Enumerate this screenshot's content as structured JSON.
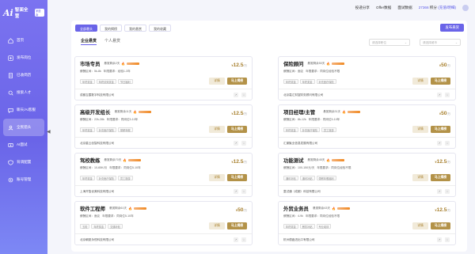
{
  "app": {
    "logo_mark": "Ai",
    "name": "智面全营",
    "tag": "家庭版"
  },
  "sidebar": {
    "items": [
      {
        "label": "首页",
        "icon": "home-icon",
        "active": false
      },
      {
        "label": "发布岗位",
        "icon": "post-icon",
        "active": false
      },
      {
        "label": "已收简历",
        "icon": "resume-icon",
        "active": false
      },
      {
        "label": "搜索人才",
        "icon": "search-icon",
        "active": false
      },
      {
        "label": "聊天/AI客服",
        "icon": "chat-icon",
        "active": false
      },
      {
        "label": "全民猎头",
        "icon": "hunter-icon",
        "active": true
      },
      {
        "label": "AI面试",
        "icon": "interview-icon",
        "active": false
      },
      {
        "label": "背调配置",
        "icon": "check-icon",
        "active": false
      },
      {
        "label": "账号管理",
        "icon": "account-icon",
        "active": false
      }
    ],
    "collapse_glyph": "◀"
  },
  "topbar": {
    "invite": "投递分享",
    "offer": "Offer数据",
    "interview": "面试数据",
    "credits": "27366",
    "credits_unit": "积分",
    "recharge": "(充值/明细)"
  },
  "tabs": [
    {
      "label": "全部悬头",
      "active": true
    },
    {
      "label": "我的揭榜",
      "active": false
    },
    {
      "label": "我的悬赏",
      "active": false
    },
    {
      "label": "我的收藏",
      "active": false
    }
  ],
  "publish_button": "发布悬赏",
  "subtabs": [
    {
      "label": "企业悬赏",
      "active": true
    },
    {
      "label": "个人悬赏",
      "active": false
    }
  ],
  "filters": [
    {
      "placeholder": "请选择职位"
    },
    {
      "placeholder": "请选择城市"
    }
  ],
  "common": {
    "detail": "详情",
    "grab": "马上揭榜",
    "yen": "¥",
    "unit": "/万"
  },
  "cards": [
    {
      "title": "市场专员",
      "remaining": "悬赏剩余2天",
      "salary": "薪酬区间：5k-8k",
      "req": "年限要求：经验1-3年",
      "tags": [
        "年终奖金",
        "年终绩效奖金",
        "节日福利"
      ],
      "price": "12.5",
      "company": "成都吉露数字科技有限公司"
    },
    {
      "title": "保险顾问",
      "remaining": "悬赏剩余50天",
      "salary": "薪酬区间：面议",
      "req": "年限要求：同岗位经验不限",
      "tags": [
        "年终奖金",
        "年终奖金",
        "补充医疗保险"
      ],
      "price": "50",
      "company": "北京嘉汇财富财务顾问有限公司"
    },
    {
      "title": "高级开发组长",
      "remaining": "悬赏剩余11天",
      "salary": "薪酬区间：22k-28k",
      "req": "年限要求：同岗位5-10年",
      "tags": [
        "年终奖金",
        "补充医疗保险",
        "带薪年假"
      ],
      "price": "12.5",
      "company": "北京星云创智科技有限公司"
    },
    {
      "title": "项目经理/主管",
      "remaining": "悬赏剩余31天",
      "salary": "薪酬区间：8k-12k",
      "req": "年限要求：同岗位5-10年",
      "tags": [
        "年终奖金",
        "补充医疗保险",
        "员工旅游"
      ],
      "price": "50",
      "company": "汇景聚业信息发展有限公司"
    },
    {
      "title": "驾校教练",
      "remaining": "悬赏剩余70天",
      "salary": "薪酬区间：10-65K/月",
      "req": "年限要求：同岗位5-10年",
      "tags": [
        "年终奖金",
        "补充医疗保险",
        "员工旅游"
      ],
      "price": "12.5",
      "company": "上海开智优美科技有限公司"
    },
    {
      "title": "功能测试",
      "remaining": "悬赏剩余45天",
      "salary": "薪酬区间：100-150元/天",
      "req": "年限要求：同岗位经验不限",
      "tags": [
        "通讯补贴",
        "通讯补贴",
        "带薪年假福利"
      ],
      "price": "12.5",
      "company": "童试通（成都）科技有限公司"
    },
    {
      "title": "软件工程师",
      "remaining": "悬赏剩余61天",
      "salary": "薪酬区间：面议",
      "req": "年限要求：同岗位5-10年",
      "tags": [
        "五险",
        "年终奖金",
        "交通补贴"
      ],
      "price": "50",
      "company": "北京朝夏永恒科技有限公司"
    },
    {
      "title": "外贸业务员",
      "remaining": "悬赏剩余43天",
      "salary": "薪酬区间：4-9k",
      "req": "年限要求：同岗位经验不限",
      "tags": [
        "年终奖金",
        "餐饮补贴",
        "专业培训"
      ],
      "price": "12.5",
      "company": "杭州德鑫进出口有限公司"
    }
  ]
}
